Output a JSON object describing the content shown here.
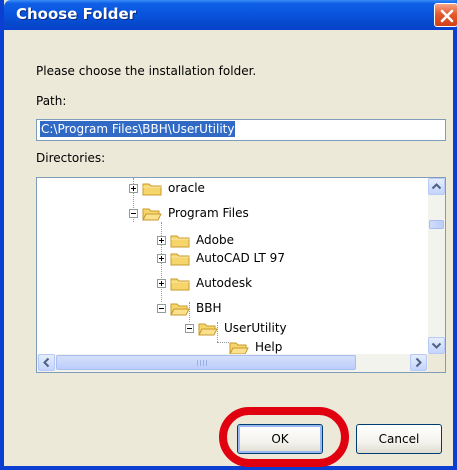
{
  "window": {
    "title": "Choose Folder"
  },
  "dialog": {
    "instruction": "Please choose the installation folder.",
    "path_label": "Path:",
    "path_value": "C:\\Program Files\\BBH\\UserUtility",
    "directories_label": "Directories:"
  },
  "tree": {
    "items": [
      {
        "label": "oracle",
        "expander": "plus"
      },
      {
        "label": "Program Files",
        "expander": "minus"
      },
      {
        "label": "Adobe",
        "expander": "plus"
      },
      {
        "label": "AutoCAD LT 97",
        "expander": "plus"
      },
      {
        "label": "Autodesk",
        "expander": "plus"
      },
      {
        "label": "BBH",
        "expander": "minus"
      },
      {
        "label": "UserUtility",
        "expander": "minus"
      },
      {
        "label": "Help",
        "expander": "none"
      }
    ]
  },
  "buttons": {
    "ok": "OK",
    "cancel": "Cancel"
  },
  "icons": {
    "close": "close-icon",
    "folder": "folder-icon",
    "scroll_up": "arrow-up-icon",
    "scroll_down": "arrow-down-icon",
    "scroll_left": "arrow-left-icon",
    "scroll_right": "arrow-right-icon"
  },
  "colors": {
    "title_bar": "#0853dc",
    "selection": "#316ac5",
    "highlight": "#e0000f"
  }
}
